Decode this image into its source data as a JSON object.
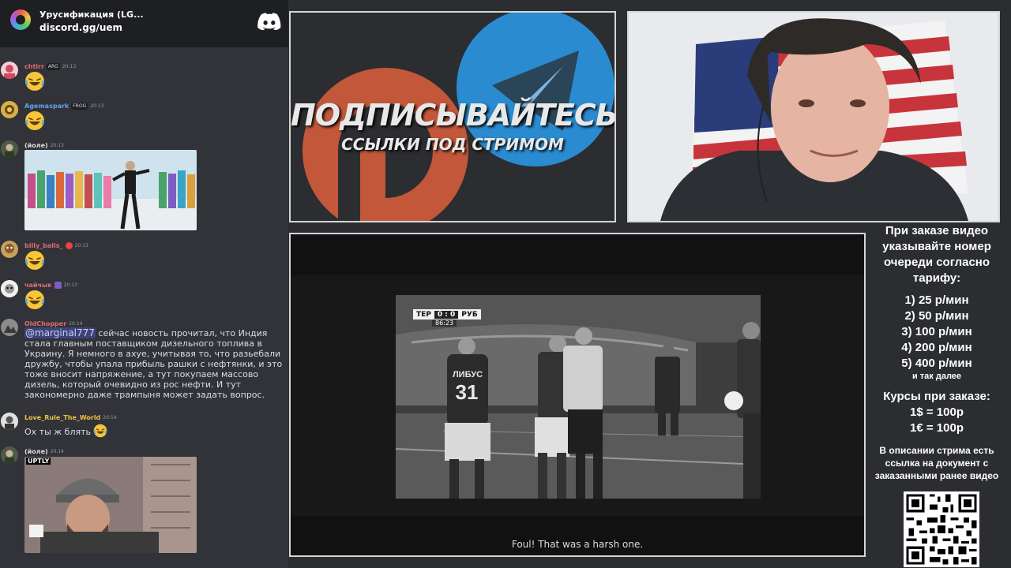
{
  "server": {
    "name": "Урусификация (LG...",
    "invite": "discord.gg/uem"
  },
  "messages": [
    {
      "username": "chtirr",
      "badge": "ARG",
      "time": "20:13",
      "emoji": "laughing-crying-emoji",
      "name_color": "#e06c75"
    },
    {
      "username": "Agemaspark",
      "badge": "FROG",
      "time": "20:13",
      "emoji": "laughing-crying-emoji",
      "name_color": "#5ea3e8"
    },
    {
      "username": "(йоле)",
      "time": "20:13",
      "attachment": "dancing-man-photo",
      "name_color": "#dcdcdc"
    },
    {
      "username": "billy_balls_",
      "time": "20:13",
      "emoji": "laughing-crying-emoji",
      "name_color": "#e06c75"
    },
    {
      "username": "чайчык",
      "time": "20:13",
      "emoji": "laughing-crying-emoji",
      "name_color": "#e06c75"
    },
    {
      "username": "OldChopper",
      "time": "20:14",
      "name_color": "#e06c75",
      "mention": "@marginal777",
      "text": " сейчас новость прочитал, что Индия стала главным поставщиком дизельного топлива в Украину. Я немного в ахуе, учитывая то, что разьебали дружбу, чтобы упала прибыль рашки с нефтянки, и это тоже вносит напряжение, а тут покупаем массово дизель, который очевидно из рос нефти. И тут закономерно даже трампыня может задать вопрос."
    },
    {
      "username": "Love_Rule_The_World",
      "time": "20:14",
      "text": "Ох ты ж блять",
      "name_color": "#f0c040"
    },
    {
      "username": "(йоле)",
      "time": "20:14",
      "attachment": "helmet-man-photo",
      "attachment_label": "UPTLY",
      "name_color": "#dcdcdc"
    }
  ],
  "promo": {
    "title": "ПОДПИСЫВАЙТЕСЬ",
    "subtitle": "ССЫЛКИ ПОД СТРИМОМ"
  },
  "video": {
    "scoreboard": {
      "home": "ТЕР",
      "score": "0 : 0",
      "away": "РУБ",
      "clock": "86:23"
    },
    "player_number": "31",
    "player_name": "ЛИБУС",
    "subtitle": "Foul! That was a harsh one."
  },
  "info": {
    "heading": "При заказе видео указывайте номер очереди согласно тарифу:",
    "tariffs": [
      "1) 25 р/мин",
      "2) 50 р/мин",
      "3) 100 р/мин",
      "4) 200 р/мин",
      "5) 400 р/мин"
    ],
    "tariff_more": "и так далее",
    "rates_title": "Курсы при заказе:",
    "rates": [
      "1$ = 100р",
      "1€ = 100р"
    ],
    "description": "В описании стрима есть ссылка на документ с заказанными ранее видео"
  },
  "colors": {
    "discord_bg": "#313338",
    "server_bar": "#1e1f22",
    "telegram_blue": "#2a8bd0",
    "patreon_orange": "#c2573a"
  }
}
